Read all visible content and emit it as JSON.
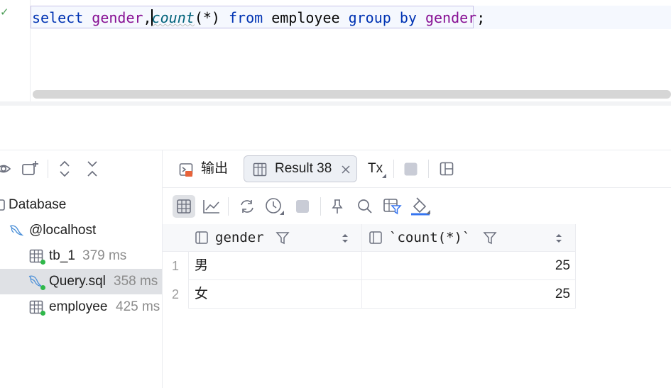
{
  "editor": {
    "sql_tokens": [
      {
        "text": "select",
        "kind": "kw"
      },
      {
        "text": " ",
        "kind": "plain"
      },
      {
        "text": "gender",
        "kind": "col"
      },
      {
        "text": ",",
        "kind": "plain"
      },
      {
        "text": "count",
        "kind": "fn"
      },
      {
        "text": "(*) ",
        "kind": "plain"
      },
      {
        "text": "from",
        "kind": "kw"
      },
      {
        "text": " employee ",
        "kind": "plain"
      },
      {
        "text": "group by",
        "kind": "kw"
      },
      {
        "text": " ",
        "kind": "plain"
      },
      {
        "text": "gender",
        "kind": "col"
      },
      {
        "text": ";",
        "kind": "plain"
      }
    ],
    "status_icon": "check-icon"
  },
  "services_tree": {
    "root": {
      "label": "Database"
    },
    "host": {
      "label": "@localhost"
    },
    "items": [
      {
        "label": "tb_1",
        "time": "379 ms",
        "icon": "table-icon",
        "selected": false
      },
      {
        "label": "Query.sql",
        "time": "358 ms",
        "icon": "console-icon",
        "selected": true
      },
      {
        "label": "employee",
        "time": "425 ms",
        "icon": "table-icon",
        "selected": false
      }
    ]
  },
  "result_tabs": {
    "output_label": "输出",
    "result_label": "Result 38",
    "tx_label": "Tx"
  },
  "table": {
    "columns": [
      "gender",
      "`count(*)`"
    ],
    "rows": [
      {
        "num": "1",
        "gender": "男",
        "count": "25"
      },
      {
        "num": "2",
        "gender": "女",
        "count": "25"
      }
    ]
  },
  "colors": {
    "keyword": "#0033b3",
    "column": "#871094",
    "function": "#00627a",
    "connected_dot": "#2fb84a"
  }
}
